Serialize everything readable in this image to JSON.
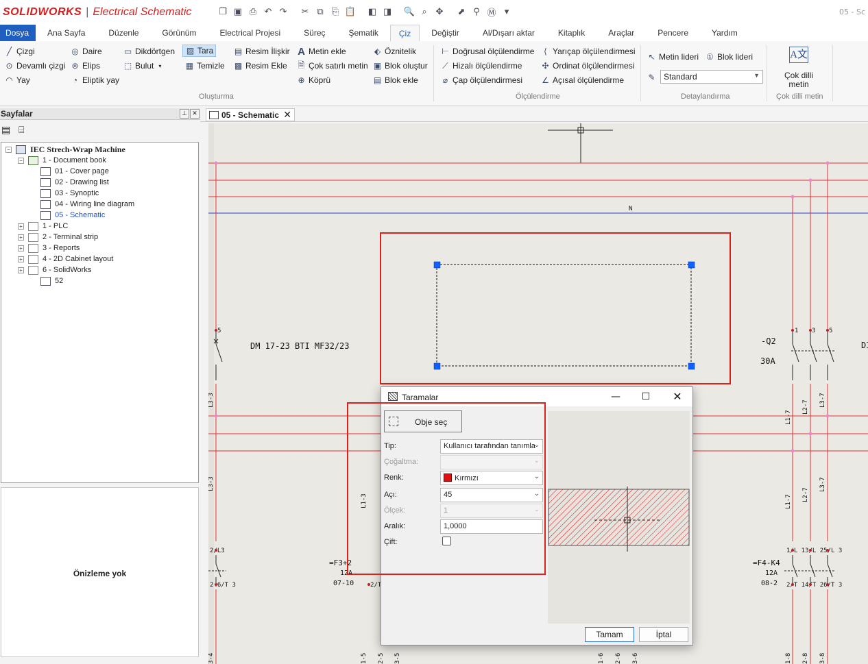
{
  "app": {
    "brand": "SOLIDWORKS",
    "product": "Electrical Schematic",
    "title_right": "05 - Sc"
  },
  "menu": {
    "file": "Dosya",
    "tabs": [
      "Ana Sayfa",
      "Düzenle",
      "Görünüm",
      "Electrical Projesi",
      "Süreç",
      "Şematik",
      "Çiz",
      "Değiştir",
      "Al/Dışarı aktar",
      "Kitaplık",
      "Araçlar",
      "Pencere",
      "Yardım"
    ],
    "active_tab": "Çiz"
  },
  "ribbon": {
    "olusturma": {
      "label": "Oluşturma",
      "cizgi": "Çizgi",
      "devamli_cizgi": "Devamlı çizgi",
      "yay": "Yay",
      "daire": "Daire",
      "elips": "Elips",
      "eliptik_yay": "Eliptik yay",
      "dikdortgen": "Dikdörtgen",
      "bulut": "Bulut",
      "tara": "Tara",
      "temizle": "Temizle",
      "resim_iliskir": "Resim İlişkir",
      "resim_ekle": "Resim Ekle",
      "metin_ekle": "Metin ekle",
      "cok_satirli_metin": "Çok satırlı metin",
      "kopru": "Köprü",
      "oznitelik": "Öznitelik",
      "blok_olustur": "Blok oluştur",
      "blok_ekle": "Blok ekle"
    },
    "olculendirme": {
      "label": "Ölçülendirme",
      "dogrusal": "Doğrusal ölçülendirme",
      "hizali": "Hizalı ölçülendirme",
      "cap": "Çap ölçülendirmesi",
      "yaricap": "Yarıçap ölçülendirmesi",
      "ordinat": "Ordinat ölçülendirmesi",
      "acisal": "Açısal ölçülendirme"
    },
    "detaylandirma": {
      "label": "Detaylandırma",
      "metin_lideri": "Metin lideri",
      "blok_lideri": "Blok lideri",
      "style": "Standard"
    },
    "cok_dilli": {
      "label": "Çok dilli metin",
      "button": "Çok dilli metin"
    }
  },
  "pages_panel": {
    "title": "Sayfalar",
    "tree": [
      {
        "label": "IEC Strech-Wrap Machine",
        "level": 0,
        "icon": "machine-icon",
        "expander": "−"
      },
      {
        "label": "1 - Document book",
        "level": 1,
        "icon": "book-icon",
        "expander": "−"
      },
      {
        "label": "01 - Cover page",
        "level": 2,
        "icon": "cover-page-icon",
        "expander": ""
      },
      {
        "label": "02 - Drawing list",
        "level": 2,
        "icon": "list-page-icon",
        "expander": ""
      },
      {
        "label": "03 - Synoptic",
        "level": 2,
        "icon": "synoptic-page-icon",
        "expander": ""
      },
      {
        "label": "04 - Wiring line diagram",
        "level": 2,
        "icon": "wiring-page-icon",
        "expander": ""
      },
      {
        "label": "05 - Schematic",
        "level": 2,
        "icon": "schematic-page-icon",
        "expander": "",
        "selected": true
      },
      {
        "label": "1 - PLC",
        "level": 1,
        "icon": "folder-icon",
        "expander": "+"
      },
      {
        "label": "2 - Terminal strip",
        "level": 1,
        "icon": "folder-icon",
        "expander": "+"
      },
      {
        "label": "3 - Reports",
        "level": 1,
        "icon": "folder-icon",
        "expander": "+"
      },
      {
        "label": "4 - 2D Cabinet layout",
        "level": 1,
        "icon": "folder-icon",
        "expander": "+"
      },
      {
        "label": "6 - SolidWorks",
        "level": 1,
        "icon": "folder-icon",
        "expander": "+"
      },
      {
        "label": "52",
        "level": 2,
        "icon": "schematic-page-icon",
        "expander": ""
      }
    ],
    "preview_text": "Önizleme yok"
  },
  "document_tab": {
    "label": "05 - Schematic",
    "close": "✕"
  },
  "schematic": {
    "n_label": "N",
    "dm_label": "DM 17-23 BTI MF32/23",
    "q2_label": "-Q2",
    "q2_rating": "30A",
    "dl_label": "DI",
    "f3_label": "=F3+2",
    "f3_rating": "12A",
    "f3_ref": "07-10",
    "f4_label": "=F4-K4",
    "f4_rating": "12A",
    "f4_ref": "08-2",
    "term_5": "5",
    "term_1": "1",
    "term_3": "3",
    "top_terms": "2/L3",
    "top_terms_right": "1/L 13/L 25/L 3",
    "bottom_terms_left": "2 6/T 3",
    "bottom_terms_right": "2/T 14/T 26/T 3",
    "wire_l33": "L3-3",
    "wire_l13": "L1-3",
    "wire_l17": "L1-7",
    "wire_l27": "L2-7",
    "wire_l37": "L3-7",
    "bottom_wires": [
      "3-4",
      "1-5",
      "2-5",
      "3-5",
      "1-6",
      "2-6",
      "3-6",
      "1-8",
      "2-8",
      "3-8"
    ],
    "f3_partial": "2/T"
  },
  "dialog": {
    "title": "Taramalar",
    "select_object": "Obje seç",
    "fields": {
      "tip": {
        "label": "Tip:",
        "value": "Kullanıcı tarafından tanımla"
      },
      "cogaltma": {
        "label": "Çoğaltma:",
        "value": ""
      },
      "renk": {
        "label": "Renk:",
        "value": "Kırmızı",
        "color": "#e01010"
      },
      "aci": {
        "label": "Açı:",
        "value": "45"
      },
      "olcek": {
        "label": "Ölçek:",
        "value": "1"
      },
      "aralik": {
        "label": "Aralık:",
        "value": "1,0000"
      },
      "cift": {
        "label": "Çift:",
        "checked": false
      }
    },
    "ok": "Tamam",
    "cancel": "İptal"
  },
  "colors": {
    "accent": "#1f5fbf",
    "highlight": "#e02018",
    "wire": "#e03030",
    "neutral_wire": "#2040c0",
    "handle": "#1060ff"
  }
}
